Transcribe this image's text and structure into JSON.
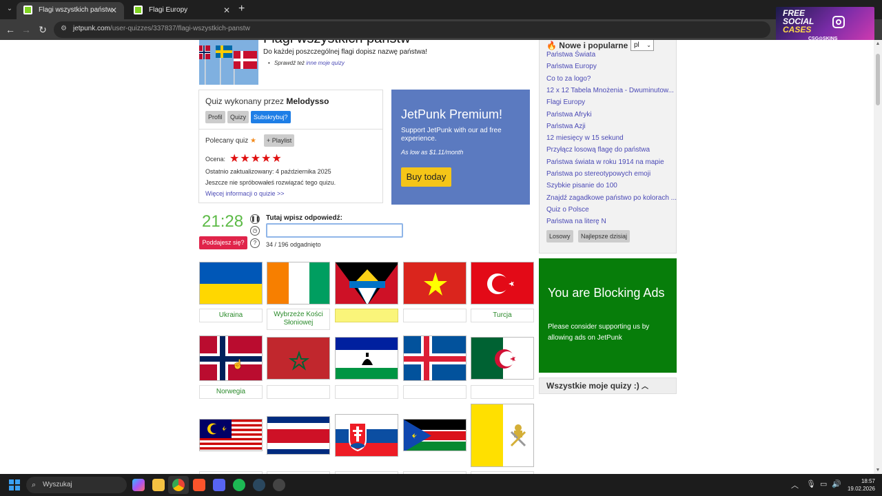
{
  "browser": {
    "tabs": [
      {
        "title": "Flagi wszystkich państw",
        "active": true
      },
      {
        "title": "Flagi Europy",
        "active": false
      }
    ],
    "url_domain": "jetpunk.com",
    "url_path": "/user-quizzes/337837/flagi-wszystkich-panstw"
  },
  "ad_banner": {
    "line1": "FREE",
    "line2": "SOCIAL",
    "line3": "CASES",
    "brand": "CSG⊙SKINS"
  },
  "quiz": {
    "title": "Flagi wszystkich państw",
    "description": "Do każdej poszczególnej flagi dopisz nazwę państwa!",
    "see_also_prefix": "Sprawdź też",
    "see_also_link": "inne moje quizy",
    "made_by_prefix": "Quiz wykonany przez",
    "author": "Melodysso",
    "profile_btn": "Profil",
    "quizzes_btn": "Quizy",
    "subscribe_btn": "Subskrybuj?",
    "featured_label": "Polecany quiz",
    "playlist_btn": "+ Playlist",
    "rating_label": "Ocena:",
    "rating": 5,
    "updated": "Ostatnio zaktualizowany: 4 października 2025",
    "not_tried": "Jeszcze nie spróbowałeś rozwiązać tego quizu.",
    "more_info": "Więcej informacji o quizie >>"
  },
  "premium": {
    "title": "JetPunk Premium!",
    "text": "Support JetPunk with our ad free experience.",
    "price": "As low as $1.11/month",
    "buy_btn": "Buy today"
  },
  "game": {
    "timer": "21:28",
    "give_up": "Poddajesz się?",
    "answer_label": "Tutaj wpisz odpowiedź:",
    "answer_value": "",
    "progress": "34 / 196 odgadnięto"
  },
  "flags": [
    {
      "country": "ukraine",
      "answer": "Ukraina"
    },
    {
      "country": "ivory-coast",
      "answer": "Wybrzeże Kości Słoniowej"
    },
    {
      "country": "antigua",
      "answer": ""
    },
    {
      "country": "vietnam",
      "answer": ""
    },
    {
      "country": "turkey",
      "answer": "Turcja"
    },
    {
      "country": "norway",
      "answer": "Norwegia"
    },
    {
      "country": "morocco",
      "answer": ""
    },
    {
      "country": "lesotho",
      "answer": ""
    },
    {
      "country": "iceland",
      "answer": ""
    },
    {
      "country": "algeria",
      "answer": ""
    },
    {
      "country": "malaysia",
      "answer": ""
    },
    {
      "country": "costa-rica",
      "answer": ""
    },
    {
      "country": "slovakia",
      "answer": ""
    },
    {
      "country": "south-sudan",
      "answer": ""
    },
    {
      "country": "vatican",
      "answer": ""
    }
  ],
  "sidebar": {
    "title": "Nowe i popularne",
    "language": "pl",
    "links": [
      "Państwa Świata",
      "Państwa Europy",
      "Co to za logo?",
      "12 x 12 Tabela Mnożenia - Dwuminutow...",
      "Flagi Europy",
      "Państwa Afryki",
      "Państwa Azji",
      "12 miesięcy w 15 sekund",
      "Przyłącz losową flagę do państwa",
      "Państwa świata w roku 1914 na mapie",
      "Państwa po stereotypowych emoji",
      "Szybkie pisanie do 100",
      "Znajdź zagadkowe państwo po kolorach ...",
      "Quiz o Polsce",
      "Państwa na literę N"
    ],
    "random_btn": "Losowy",
    "best_today_btn": "Najlepsze dzisiaj"
  },
  "blocking": {
    "title": "You are Blocking Ads",
    "text": "Please consider supporting us by allowing ads on JetPunk"
  },
  "all_quizzes": "Wszystkie moje quizy :)",
  "taskbar": {
    "search_placeholder": "Wyszukaj",
    "time": "18:57",
    "date": "19.02.2026"
  }
}
